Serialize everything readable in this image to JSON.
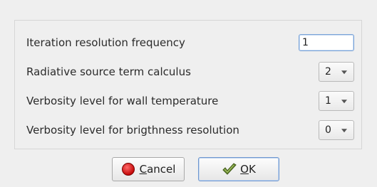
{
  "form": {
    "rows": [
      {
        "label": "Iteration resolution frequency",
        "type": "text",
        "value": "1"
      },
      {
        "label": "Radiative source term calculus",
        "type": "select",
        "value": "2"
      },
      {
        "label": "Verbosity level for wall temperature",
        "type": "select",
        "value": "1"
      },
      {
        "label": "Verbosity level for brigthness resolution",
        "type": "select",
        "value": "0"
      }
    ]
  },
  "buttons": {
    "cancel": {
      "mnemonic": "C",
      "rest": "ancel",
      "icon": "stop-icon",
      "icon_color": "#e01b1b"
    },
    "ok": {
      "mnemonic": "O",
      "rest": "K",
      "icon": "check-icon",
      "icon_color": "#5e7b2e"
    }
  },
  "colors": {
    "background": "#efefef",
    "panel_border": "#d6d6d6",
    "focus_accent": "#7aa3d8"
  }
}
